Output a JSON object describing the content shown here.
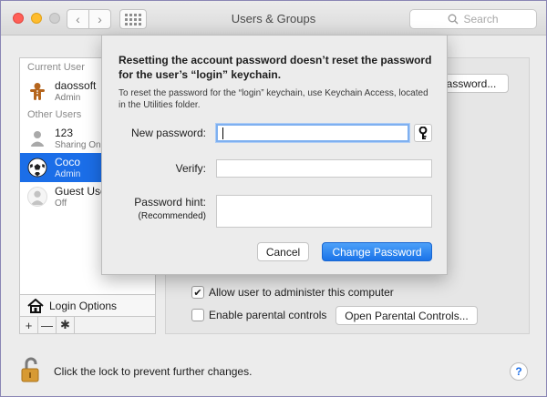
{
  "window": {
    "title": "Users & Groups"
  },
  "toolbar": {
    "search_placeholder": "Search"
  },
  "users": {
    "current_header": "Current User",
    "other_header": "Other Users",
    "current": [
      {
        "name": "daossoft",
        "role": "Admin"
      }
    ],
    "others": [
      {
        "name": "123",
        "role": "Sharing Only"
      },
      {
        "name": "Coco",
        "role": "Admin",
        "selected": true
      },
      {
        "name": "Guest User",
        "role": "Off"
      }
    ],
    "login_options": "Login Options",
    "add": "+",
    "remove": "—"
  },
  "pane": {
    "change_password_partial": "assword...",
    "allow_admin_label": "Allow user to administer this computer",
    "allow_admin_checked": true,
    "parental_label": "Enable parental controls",
    "parental_checked": false,
    "parental_button": "Open Parental Controls..."
  },
  "footer": {
    "lock_text": "Click the lock to prevent further changes.",
    "help": "?"
  },
  "sheet": {
    "title": "Resetting the account password doesn’t reset the password for the user’s “login” keychain.",
    "subtitle": "To reset the password for the “login” keychain, use Keychain Access, located in the Utilities folder.",
    "new_password_label": "New password:",
    "verify_label": "Verify:",
    "hint_label": "Password hint:",
    "hint_sub": "(Recommended)",
    "new_password_value": "",
    "verify_value": "",
    "hint_value": "",
    "cancel": "Cancel",
    "change": "Change Password"
  }
}
